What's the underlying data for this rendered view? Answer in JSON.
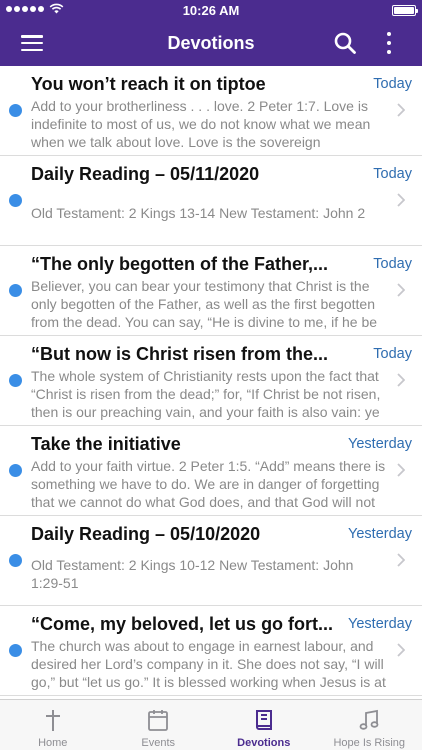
{
  "status_bar": {
    "time": "10:26 AM",
    "battery_level": 1.0
  },
  "nav": {
    "title": "Devotions",
    "menu_icon": "hamburger-icon",
    "search_icon": "search-icon",
    "more_icon": "more-vertical-icon"
  },
  "devotions": [
    {
      "title": "You won’t reach it on tiptoe",
      "date": "Today",
      "unread": true,
      "body": "Add to your brotherliness . . . love. 2 Peter 1:7. Love is indefinite to most of us, we do not know what we mean when we talk about love. Love is the sovereign preference"
    },
    {
      "title": "Daily Reading – 05/11/2020",
      "date": "Today",
      "unread": true,
      "body": "Old Testament: 2 Kings 13-14 New Testament: John 2"
    },
    {
      "title": "“The only begotten of the Father,...",
      "date": "Today",
      "unread": true,
      "body": "Believer, you can bear your testimony that Christ is the only begotten of the Father, as well as the first begotten from the dead. You can say, “He is divine to me, if he be"
    },
    {
      "title": "“But now is Christ risen from the...",
      "date": "Today",
      "unread": true,
      "body": "The whole system of Christianity rests upon the fact that “Christ is risen from the dead;” for, “If Christ be not risen, then is our preaching vain, and your faith is also vain: ye"
    },
    {
      "title": "Take the initiative",
      "date": "Yesterday",
      "unread": true,
      "body": "Add to your faith virtue. 2 Peter 1:5. “Add” means there is something we have to do. We are in danger of forgetting that we cannot do what God does, and that God will not do"
    },
    {
      "title": "Daily Reading – 05/10/2020",
      "date": "Yesterday",
      "unread": true,
      "body": "Old Testament: 2 Kings 10-12 New Testament: John 1:29-51"
    },
    {
      "title": "“Come, my beloved, let us go fort...",
      "date": "Yesterday",
      "unread": true,
      "body": "The church was about to engage in earnest labour, and desired her Lord’s company in it. She does not say, “I will go,” but “let us go.” It is blessed working when Jesus is at"
    }
  ],
  "tabs": [
    {
      "label": "Home",
      "icon": "cross-icon",
      "active": false
    },
    {
      "label": "Events",
      "icon": "calendar-icon",
      "active": false
    },
    {
      "label": "Devotions",
      "icon": "book-icon",
      "active": true
    },
    {
      "label": "Hope Is Rising",
      "icon": "music-note-icon",
      "active": false
    }
  ],
  "colors": {
    "brand": "#4b2c8f",
    "unread_dot": "#3a8ee6",
    "date": "#2f6db1",
    "tab_inactive": "#8e8e93"
  }
}
